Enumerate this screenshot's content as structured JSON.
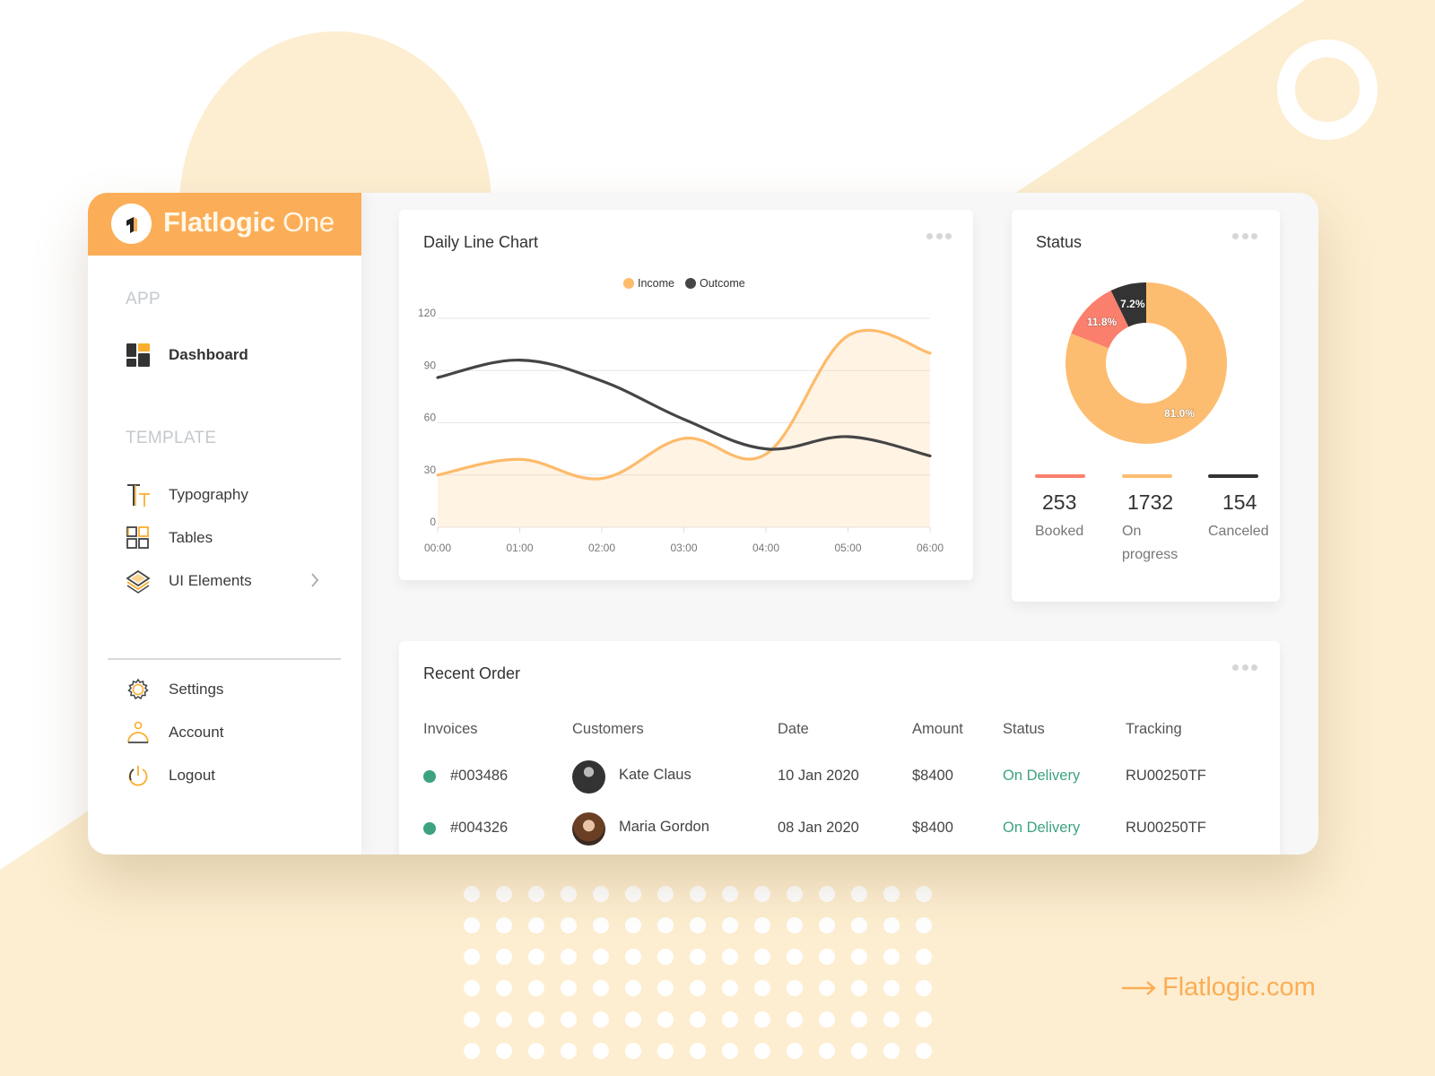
{
  "brand": {
    "name_bold": "Flatlogic",
    "name_light": "One",
    "logo_icon": "flatlogic-logo-icon",
    "accent_color": "#fbae57"
  },
  "sidebar": {
    "sections": [
      {
        "label": "APP",
        "items": [
          {
            "label": "Dashboard",
            "icon": "dashboard-icon",
            "active": true
          }
        ]
      },
      {
        "label": "TEMPLATE",
        "items": [
          {
            "label": "Typography",
            "icon": "typography-icon"
          },
          {
            "label": "Tables",
            "icon": "tables-icon"
          },
          {
            "label": "UI Elements",
            "icon": "layers-icon",
            "has_submenu": true
          }
        ]
      }
    ],
    "bottom_items": [
      {
        "label": "Settings",
        "icon": "gear-icon"
      },
      {
        "label": "Account",
        "icon": "user-icon"
      },
      {
        "label": "Logout",
        "icon": "power-icon"
      }
    ]
  },
  "line_chart_card": {
    "title": "Daily Line Chart",
    "menu_icon": "more-dots-icon"
  },
  "chart_data": [
    {
      "type": "area",
      "title": "Daily Line Chart",
      "x": [
        "00:00",
        "01:00",
        "02:00",
        "03:00",
        "04:00",
        "05:00",
        "06:00"
      ],
      "series": [
        {
          "name": "Income",
          "color": "#fdbb6b",
          "filled": true,
          "values": [
            30,
            39,
            28,
            51,
            42,
            110,
            100
          ]
        },
        {
          "name": "Outcome",
          "color": "#454545",
          "filled": false,
          "values": [
            86,
            96,
            84,
            62,
            45,
            52,
            41
          ]
        }
      ],
      "y_ticks": [
        "0",
        "30",
        "60",
        "90",
        "120"
      ],
      "ylim": [
        0,
        120
      ],
      "grid": true,
      "legend": "top-center",
      "xlabel": "",
      "ylabel": ""
    },
    {
      "type": "pie",
      "title": "Status",
      "donut": true,
      "categories": [
        "On progress",
        "Booked",
        "Canceled"
      ],
      "values": [
        81.0,
        11.8,
        7.2
      ],
      "labels": [
        "81.0%",
        "11.8%",
        "7.2%"
      ],
      "colors": [
        "#fdbd70",
        "#fa7f6c",
        "#333333"
      ]
    }
  ],
  "status_card": {
    "title": "Status",
    "menu_icon": "more-dots-icon",
    "stats": [
      {
        "value": "253",
        "label": "Booked",
        "color": "#fa7f6c"
      },
      {
        "value": "1732",
        "label": "On progress",
        "color": "#fdbd70"
      },
      {
        "value": "154",
        "label": "Canceled",
        "color": "#333333"
      }
    ]
  },
  "orders_card": {
    "title": "Recent Order",
    "menu_icon": "more-dots-icon",
    "columns": [
      "Invoices",
      "Customers",
      "Date",
      "Amount",
      "Status",
      "Tracking"
    ],
    "rows": [
      {
        "invoice": "#003486",
        "customer": "Kate Claus",
        "date": "10 Jan 2020",
        "amount": "$8400",
        "status": "On Delivery",
        "tracking": "RU00250TF"
      },
      {
        "invoice": "#004326",
        "customer": "Maria Gordon",
        "date": "08 Jan 2020",
        "amount": "$8400",
        "status": "On Delivery",
        "tracking": "RU00250TF"
      }
    ],
    "status_color": "#3da37f"
  },
  "footer": {
    "link_text": "Flatlogic.com",
    "arrow_icon": "arrow-right-icon"
  }
}
